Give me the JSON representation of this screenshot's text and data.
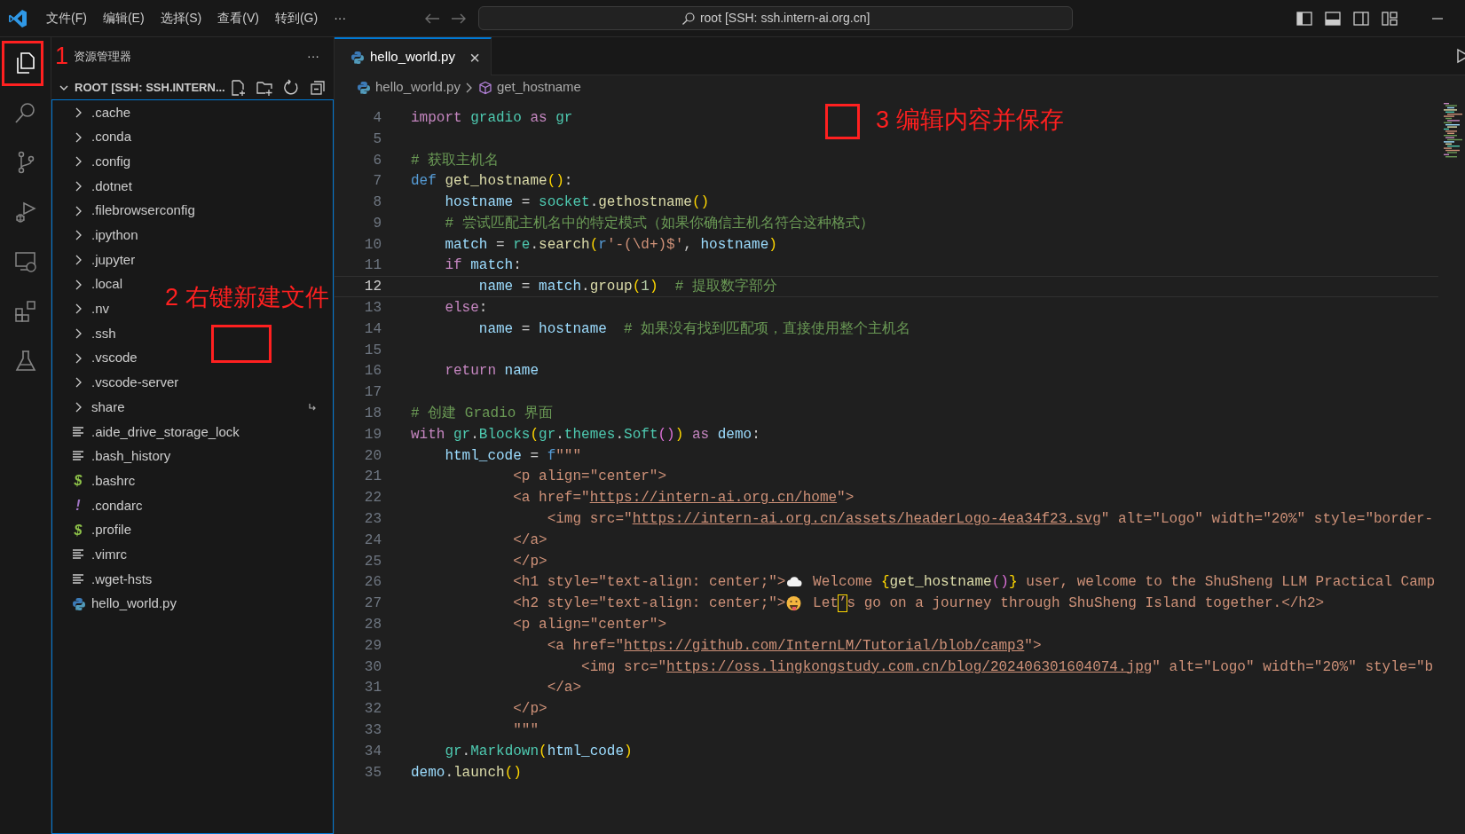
{
  "title_bar": {
    "menus": [
      "文件(F)",
      "编辑(E)",
      "选择(S)",
      "查看(V)",
      "转到(G)",
      "···"
    ],
    "command_center": "root [SSH: ssh.intern-ai.org.cn]"
  },
  "activity_bar": [
    {
      "selected": true
    },
    {
      "selected": false
    },
    {
      "selected": false
    },
    {
      "selected": false
    },
    {
      "selected": false
    },
    {
      "selected": false
    },
    {
      "selected": false
    }
  ],
  "sidebar": {
    "title": "资源管理器",
    "more": "···",
    "root": {
      "label": "ROOT [SSH: SSH.INTERN...",
      "expanded": true
    },
    "items": [
      {
        "label": ".cache",
        "kind": "folder",
        "symlink": false
      },
      {
        "label": ".conda",
        "kind": "folder",
        "symlink": false
      },
      {
        "label": ".config",
        "kind": "folder",
        "symlink": false
      },
      {
        "label": ".dotnet",
        "kind": "folder",
        "symlink": false
      },
      {
        "label": ".filebrowserconfig",
        "kind": "folder",
        "symlink": false
      },
      {
        "label": ".ipython",
        "kind": "folder",
        "symlink": false
      },
      {
        "label": ".jupyter",
        "kind": "folder",
        "symlink": false
      },
      {
        "label": ".local",
        "kind": "folder",
        "symlink": false
      },
      {
        "label": ".nv",
        "kind": "folder",
        "symlink": false
      },
      {
        "label": ".ssh",
        "kind": "folder",
        "symlink": false
      },
      {
        "label": ".vscode",
        "kind": "folder",
        "symlink": false
      },
      {
        "label": ".vscode-server",
        "kind": "folder",
        "symlink": false
      },
      {
        "label": "share",
        "kind": "folder",
        "symlink": true
      },
      {
        "label": ".aide_drive_storage_lock",
        "kind": "text",
        "symlink": false
      },
      {
        "label": ".bash_history",
        "kind": "text",
        "symlink": false
      },
      {
        "label": ".bashrc",
        "kind": "glyph",
        "icon_glyph": "$",
        "color": "#8dc149",
        "symlink": false
      },
      {
        "label": ".condarc",
        "kind": "glyph",
        "icon_glyph": "!",
        "color": "#a074c4",
        "symlink": false
      },
      {
        "label": ".profile",
        "kind": "glyph",
        "icon_glyph": "$",
        "color": "#8dc149",
        "symlink": false
      },
      {
        "label": ".vimrc",
        "kind": "text",
        "symlink": false
      },
      {
        "label": ".wget-hsts",
        "kind": "text",
        "symlink": false
      },
      {
        "label": "hello_world.py",
        "kind": "python",
        "symlink": false
      }
    ]
  },
  "tabs": [
    {
      "label": "hello_world.py",
      "selected": true,
      "close": "×"
    }
  ],
  "breadcrumb": {
    "file": "hello_world.py",
    "symbol": "get_hostname"
  },
  "editor": {
    "lines": [
      {
        "number": "4",
        "current": false,
        "tokens": [
          {
            "kind": "kw",
            "text": "import"
          },
          {
            "kind": "cls",
            "text": " gradio"
          },
          {
            "kind": "kw",
            "text": " as"
          },
          {
            "kind": "cls",
            "text": " gr"
          }
        ]
      },
      {
        "number": "5",
        "current": false
      },
      {
        "number": "6",
        "current": false,
        "tokens": [
          {
            "kind": "cmt",
            "text": "# 获取主机名"
          }
        ]
      },
      {
        "number": "7",
        "current": false,
        "tokens": [
          {
            "kind": "storage",
            "text": "def"
          },
          {
            "kind": "fn",
            "text": " get_hostname"
          },
          {
            "kind": "b1",
            "text": "()"
          },
          {
            "kind": "p",
            "text": ":"
          }
        ]
      },
      {
        "number": "8",
        "current": false,
        "tokens": [
          {
            "kind": "var",
            "text": "    hostname"
          },
          {
            "kind": "p",
            "text": " = "
          },
          {
            "kind": "cls",
            "text": "socket"
          },
          {
            "kind": "p",
            "text": "."
          },
          {
            "kind": "fn",
            "text": "gethostname"
          },
          {
            "kind": "b1",
            "text": "()"
          }
        ]
      },
      {
        "number": "9",
        "current": false,
        "tokens": [
          {
            "kind": "cmt",
            "text": "    # 尝试匹配主机名中的特定模式（如果你确信主机名符合这种格式）"
          }
        ]
      },
      {
        "number": "10",
        "current": false,
        "tokens": [
          {
            "kind": "var",
            "text": "    match"
          },
          {
            "kind": "p",
            "text": " = "
          },
          {
            "kind": "cls",
            "text": "re"
          },
          {
            "kind": "p",
            "text": "."
          },
          {
            "kind": "fn",
            "text": "search"
          },
          {
            "kind": "b1",
            "text": "("
          },
          {
            "kind": "storage",
            "text": "r"
          },
          {
            "kind": "str",
            "text": "'-(\\d+)$'"
          },
          {
            "kind": "p",
            "text": ", "
          },
          {
            "kind": "var",
            "text": "hostname"
          },
          {
            "kind": "b1",
            "text": ")"
          }
        ]
      },
      {
        "number": "11",
        "current": false,
        "tokens": [
          {
            "kind": "kw",
            "text": "    if"
          },
          {
            "kind": "var",
            "text": " match"
          },
          {
            "kind": "p",
            "text": ":"
          }
        ]
      },
      {
        "number": "12",
        "current": true,
        "tokens": [
          {
            "kind": "var",
            "text": "        name"
          },
          {
            "kind": "p",
            "text": " = "
          },
          {
            "kind": "var",
            "text": "match"
          },
          {
            "kind": "p",
            "text": "."
          },
          {
            "kind": "fn",
            "text": "group"
          },
          {
            "kind": "b1",
            "text": "("
          },
          {
            "kind": "num",
            "text": "1"
          },
          {
            "kind": "b1",
            "text": ")"
          },
          {
            "kind": "cmt",
            "text": "  # 提取数字部分"
          }
        ]
      },
      {
        "number": "13",
        "current": false,
        "tokens": [
          {
            "kind": "kw",
            "text": "    else"
          },
          {
            "kind": "p",
            "text": ":"
          }
        ]
      },
      {
        "number": "14",
        "current": false,
        "tokens": [
          {
            "kind": "var",
            "text": "        name"
          },
          {
            "kind": "p",
            "text": " = "
          },
          {
            "kind": "var",
            "text": "hostname"
          },
          {
            "kind": "cmt",
            "text": "  # 如果没有找到匹配项，直接使用整个主机名"
          }
        ]
      },
      {
        "number": "15",
        "current": false
      },
      {
        "number": "16",
        "current": false,
        "tokens": [
          {
            "kind": "kw",
            "text": "    return"
          },
          {
            "kind": "var",
            "text": " name"
          }
        ]
      },
      {
        "number": "17",
        "current": false
      },
      {
        "number": "18",
        "current": false,
        "tokens": [
          {
            "kind": "cmt",
            "text": "# 创建 Gradio 界面"
          }
        ]
      },
      {
        "number": "19",
        "current": false,
        "tokens": [
          {
            "kind": "kw",
            "text": "with"
          },
          {
            "kind": "cls",
            "text": " gr"
          },
          {
            "kind": "p",
            "text": "."
          },
          {
            "kind": "cls",
            "text": "Blocks"
          },
          {
            "kind": "b1",
            "text": "("
          },
          {
            "kind": "cls",
            "text": "gr"
          },
          {
            "kind": "p",
            "text": "."
          },
          {
            "kind": "cls",
            "text": "themes"
          },
          {
            "kind": "p",
            "text": "."
          },
          {
            "kind": "cls",
            "text": "Soft"
          },
          {
            "kind": "b2",
            "text": "()"
          },
          {
            "kind": "b1",
            "text": ")"
          },
          {
            "kind": "kw",
            "text": " as"
          },
          {
            "kind": "var",
            "text": " demo"
          },
          {
            "kind": "p",
            "text": ":"
          }
        ]
      },
      {
        "number": "20",
        "current": false,
        "tokens": [
          {
            "kind": "var",
            "text": "    html_code"
          },
          {
            "kind": "p",
            "text": " = "
          },
          {
            "kind": "storage",
            "text": "f"
          },
          {
            "kind": "str",
            "text": "\"\"\""
          }
        ]
      },
      {
        "number": "21",
        "current": false,
        "tokens": [
          {
            "kind": "str",
            "text": "            <p align=\"center\">"
          }
        ]
      },
      {
        "number": "22",
        "current": false,
        "tokens": [
          {
            "kind": "str",
            "text": "            <a href=\""
          },
          {
            "kind": "url",
            "text": "https://intern-ai.org.cn/home"
          },
          {
            "kind": "str",
            "text": "\">"
          }
        ]
      },
      {
        "number": "23",
        "current": false,
        "tokens": [
          {
            "kind": "str",
            "text": "                <img src=\""
          },
          {
            "kind": "url",
            "text": "https://intern-ai.org.cn/assets/headerLogo-4ea34f23.svg"
          },
          {
            "kind": "str",
            "text": "\" alt=\"Logo\" width=\"20%\" style=\"border-"
          }
        ]
      },
      {
        "number": "24",
        "current": false,
        "tokens": [
          {
            "kind": "str",
            "text": "            </a>"
          }
        ]
      },
      {
        "number": "25",
        "current": false,
        "tokens": [
          {
            "kind": "str",
            "text": "            </p>"
          }
        ]
      },
      {
        "number": "26",
        "current": false,
        "tokens": [
          {
            "kind": "str",
            "text": "            <h1 style=\"text-align: center;\">"
          },
          {
            "kind": "emoji"
          },
          {
            "kind": "str",
            "text": " Welcome "
          },
          {
            "kind": "b1",
            "text": "{"
          },
          {
            "kind": "fn",
            "text": "get_hostname"
          },
          {
            "kind": "b2",
            "text": "()"
          },
          {
            "kind": "b1",
            "text": "}"
          },
          {
            "kind": "str",
            "text": " user, welcome to the ShuSheng LLM Practical Camp"
          }
        ]
      },
      {
        "number": "27",
        "current": false,
        "tokens": [
          {
            "kind": "str",
            "text": "            <h2 style=\"text-align: center;\">"
          },
          {
            "kind": "emoji"
          },
          {
            "kind": "str",
            "text": " Let"
          },
          {
            "kind": "hl",
            "text": "’"
          },
          {
            "kind": "str",
            "text": "s go on a journey through ShuSheng Island together.</h2>"
          }
        ]
      },
      {
        "number": "28",
        "current": false,
        "tokens": [
          {
            "kind": "str",
            "text": "            <p align=\"center\">"
          }
        ]
      },
      {
        "number": "29",
        "current": false,
        "tokens": [
          {
            "kind": "str",
            "text": "                <a href=\""
          },
          {
            "kind": "url",
            "text": "https://github.com/InternLM/Tutorial/blob/camp3"
          },
          {
            "kind": "str",
            "text": "\">"
          }
        ]
      },
      {
        "number": "30",
        "current": false,
        "tokens": [
          {
            "kind": "str",
            "text": "                    <img src=\""
          },
          {
            "kind": "url",
            "text": "https://oss.lingkongstudy.com.cn/blog/202406301604074.jpg"
          },
          {
            "kind": "str",
            "text": "\" alt=\"Logo\" width=\"20%\" style=\"b"
          }
        ]
      },
      {
        "number": "31",
        "current": false,
        "tokens": [
          {
            "kind": "str",
            "text": "                </a>"
          }
        ]
      },
      {
        "number": "32",
        "current": false,
        "tokens": [
          {
            "kind": "str",
            "text": "            </p>"
          }
        ]
      },
      {
        "number": "33",
        "current": false,
        "tokens": [
          {
            "kind": "str",
            "text": "            \"\"\""
          }
        ]
      },
      {
        "number": "34",
        "current": false,
        "tokens": [
          {
            "kind": "cls",
            "text": "    gr"
          },
          {
            "kind": "p",
            "text": "."
          },
          {
            "kind": "cls",
            "text": "Markdown"
          },
          {
            "kind": "b1",
            "text": "("
          },
          {
            "kind": "var",
            "text": "html_code"
          },
          {
            "kind": "b1",
            "text": ")"
          }
        ]
      },
      {
        "number": "35",
        "current": false,
        "tokens": [
          {
            "kind": "var",
            "text": "demo"
          },
          {
            "kind": "p",
            "text": "."
          },
          {
            "kind": "fn",
            "text": "launch"
          },
          {
            "kind": "b1",
            "text": "()"
          }
        ]
      }
    ]
  },
  "annotations": [
    {
      "kind": "box"
    },
    {
      "kind": "label",
      "text": "1"
    },
    {
      "kind": "label",
      "text": "2 右键新建文件"
    },
    {
      "kind": "box"
    },
    {
      "kind": "box"
    },
    {
      "kind": "label",
      "text": "3 编辑内容并保存"
    }
  ]
}
